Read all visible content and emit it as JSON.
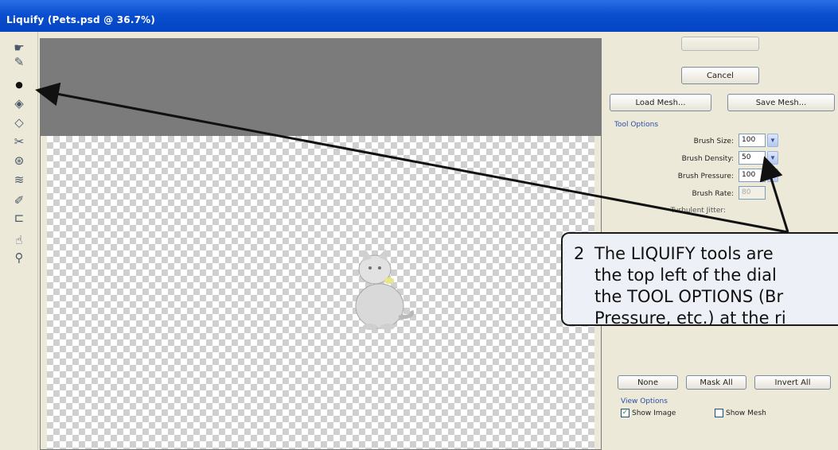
{
  "window": {
    "title": "Liquify (Pets.psd @ 36.7%)"
  },
  "tools": [
    {
      "icon": "forward-warp-icon",
      "glyph": "☛"
    },
    {
      "icon": "reconstruct-icon",
      "glyph": "✎"
    },
    {
      "icon": "twirl-icon",
      "glyph": "●"
    },
    {
      "icon": "pucker-icon",
      "glyph": "◈"
    },
    {
      "icon": "bloat-icon",
      "glyph": "◇"
    },
    {
      "icon": "push-left-icon",
      "glyph": "✂"
    },
    {
      "icon": "mirror-icon",
      "glyph": "⊛"
    },
    {
      "icon": "turbulence-icon",
      "glyph": "≋"
    },
    {
      "icon": "freeze-mask-icon",
      "glyph": "✐"
    },
    {
      "icon": "thaw-mask-icon",
      "glyph": "⊏"
    },
    {
      "icon": "hand-icon",
      "glyph": "☝"
    },
    {
      "icon": "zoom-icon",
      "glyph": "⚲"
    }
  ],
  "panel": {
    "cancel_label": "Cancel",
    "load_mesh_label": "Load Mesh...",
    "save_mesh_label": "Save Mesh...",
    "tool_options_label": "Tool Options",
    "options": [
      {
        "label": "Brush Size:",
        "value": "100"
      },
      {
        "label": "Brush Density:",
        "value": "50"
      },
      {
        "label": "Brush Pressure:",
        "value": "100"
      },
      {
        "label": "Brush Rate:",
        "value": "80"
      },
      {
        "label": "Turbulent Jitter:",
        "value": ""
      }
    ],
    "mask_buttons": {
      "none": "None",
      "mask_all": "Mask All",
      "invert_all": "Invert All"
    },
    "view_options_label": "View Options",
    "show_image_label": "Show Image",
    "show_mesh_label": "Show Mesh"
  },
  "callout": {
    "number": "2",
    "text": "The LIQUIFY tools are\nthe top left of the dial\nthe TOOL OPTIONS (Br\nPressure, etc.) at the ri"
  },
  "colors": {
    "titlebar": "#0a4fd0",
    "preview_gray": "#7b7b7b",
    "callout_bg": "#eef0f7",
    "arrow": "#111111"
  }
}
